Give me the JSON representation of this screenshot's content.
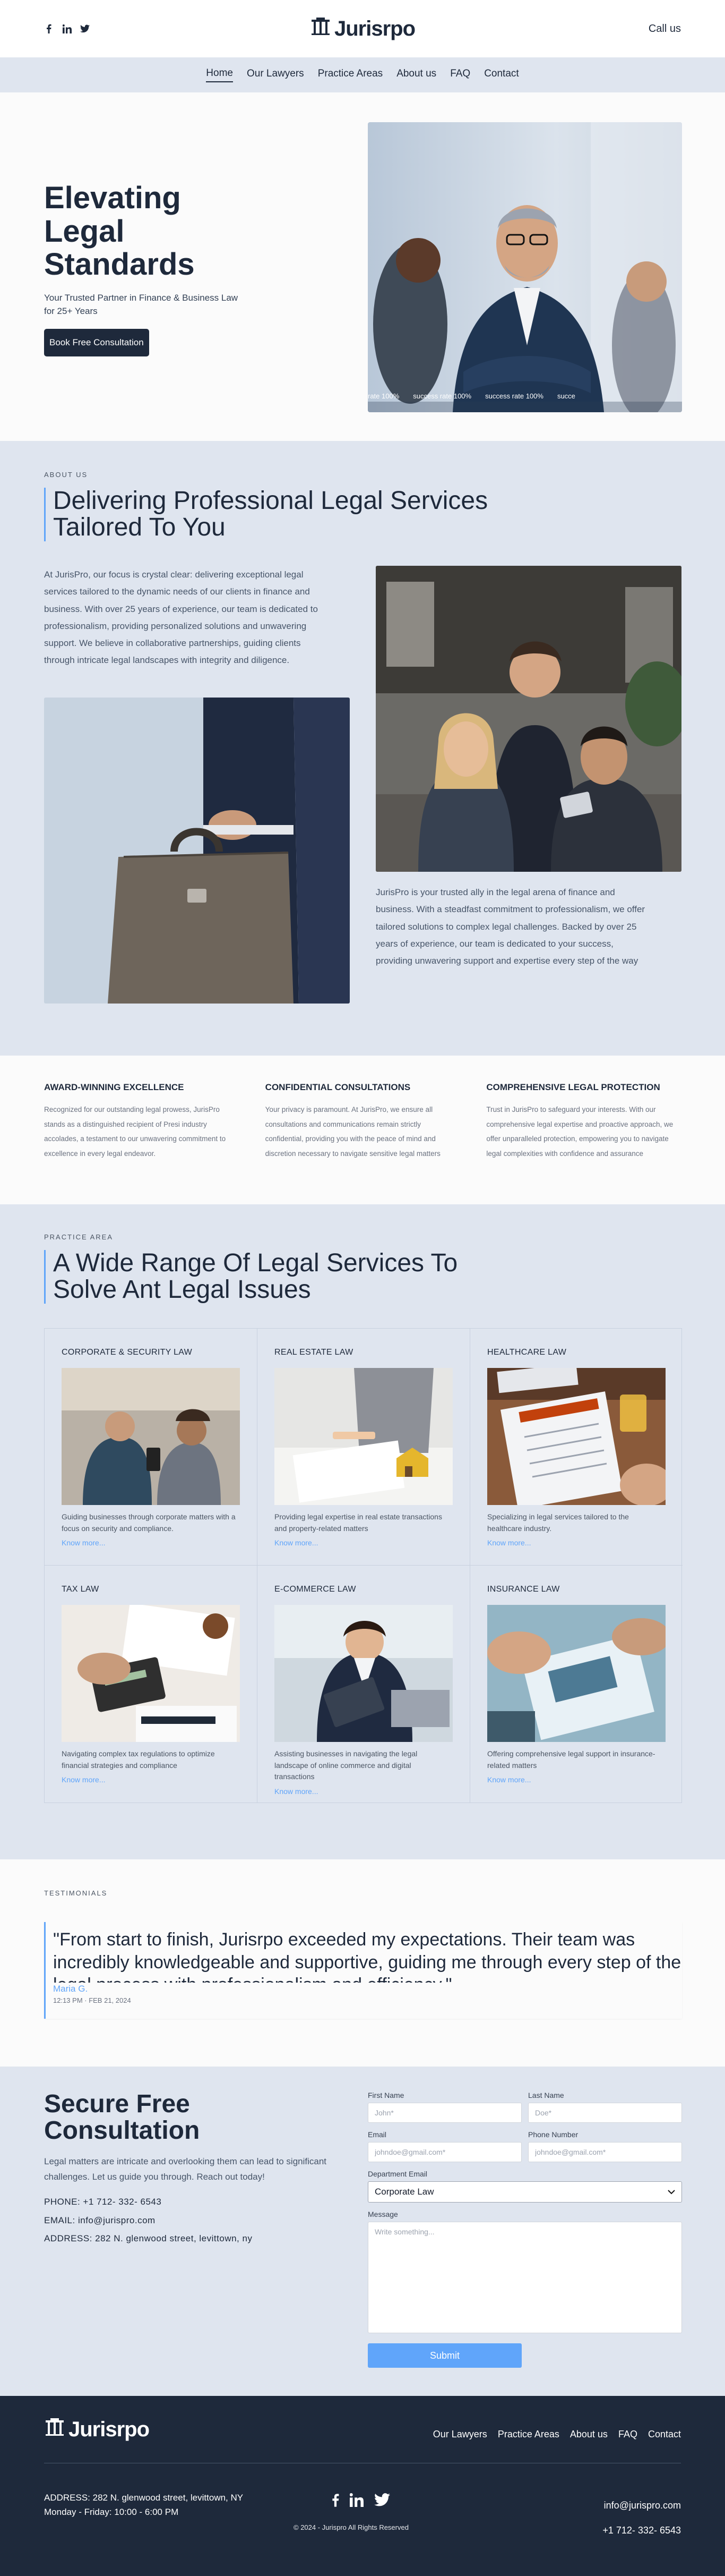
{
  "brand": {
    "name": "Jurisrpo"
  },
  "header": {
    "call_us": "Call us"
  },
  "nav": [
    "Home",
    "Our Lawyers",
    "Practice Areas",
    "About us",
    "FAQ",
    "Contact"
  ],
  "hero": {
    "title": "Elevating Legal Standards",
    "subtitle": "Your Trusted Partner in Finance & Business Law for 25+ Years",
    "cta": "Book Free Consultation",
    "image_ticker": [
      "rate 100%",
      "success rate 100%",
      "success rate 100%",
      "succe"
    ]
  },
  "about": {
    "label": "ABOUT US",
    "title": "Delivering Professional Legal Services Tailored To You",
    "p1": "At JurisPro, our focus is crystal clear: delivering exceptional legal services tailored to the dynamic needs of our clients in finance and business. With over 25 years of experience, our team is dedicated to professionalism, providing personalized solutions and unwavering support. We believe in collaborative partnerships, guiding clients through intricate legal landscapes with integrity and diligence.",
    "p2": "JurisPro is your trusted ally in the legal arena of finance and business. With a steadfast commitment to professionalism, we offer tailored solutions to complex legal challenges. Backed by over 25 years of experience, our team is dedicated to your success, providing unwavering support and expertise every step of the way"
  },
  "features": [
    {
      "title": "AWARD-WINNING EXCELLENCE",
      "text": "Recognized for our outstanding legal prowess, JurisPro stands as a distinguished recipient of Presi industry accolades, a testament to our unwavering commitment to excellence in every legal endeavor."
    },
    {
      "title": "CONFIDENTIAL CONSULTATIONS",
      "text": "Your privacy is paramount. At JurisPro, we ensure all consultations and communications remain strictly confidential, providing you with the peace of mind and discretion necessary to navigate sensitive legal matters"
    },
    {
      "title": "COMPREHENSIVE LEGAL PROTECTION",
      "text": "Trust in JurisPro to safeguard your interests. With our comprehensive legal expertise and proactive approach, we offer unparalleled protection, empowering you to navigate legal complexities with confidence and assurance"
    }
  ],
  "practice": {
    "label": "PRACTICE AREA",
    "title": "A Wide Range Of Legal Services To Solve Ant Legal Issues",
    "more": "Know more...",
    "cards": [
      {
        "title": "CORPORATE & SECURITY LAW",
        "text": "Guiding businesses through corporate matters with a focus on security and compliance."
      },
      {
        "title": "REAL ESTATE LAW",
        "text": "Providing legal expertise in real estate transactions and property-related matters"
      },
      {
        "title": "HEALTHCARE LAW",
        "text": "Specializing in legal services tailored to the healthcare industry."
      },
      {
        "title": "TAX LAW",
        "text": "Navigating complex tax regulations to optimize financial strategies and compliance"
      },
      {
        "title": "E-COMMERCE LAW",
        "text": "Assisting businesses in navigating the legal landscape of online commerce and digital transactions"
      },
      {
        "title": "INSURANCE LAW",
        "text": "Offering comprehensive legal support in insurance-related matters"
      }
    ]
  },
  "testimonials": {
    "label": "TESTIMONIALS",
    "quote": "\"From start to finish, Jurisrpo exceeded my expectations. Their team was incredibly knowledgeable and supportive, guiding me through every step of the legal process with professionalism and efficiency.\"",
    "name": "Maria G.",
    "date": "12:13 PM · FEB 21, 2024"
  },
  "contact": {
    "title": "Secure Free Consultation",
    "subtitle": "Legal matters are intricate and overlooking them can lead to significant challenges. Let us guide you through. Reach out today!",
    "phone": "PHONE: +1 712- 332- 6543",
    "email": "EMAIL: info@jurispro.com",
    "address": "ADDRESS: 282 N. glenwood street, levittown, ny",
    "form": {
      "first_label": "First Name",
      "first_ph": "John*",
      "last_label": "Last Name",
      "last_ph": "Doe*",
      "email_label": "Email",
      "email_ph": "johndoe@gmail.com*",
      "phone_label": "Phone Number",
      "phone_ph": "johndoe@gmail.com*",
      "dept_label": "Department Email",
      "dept_value": "Corporate Law",
      "message_label": "Message",
      "message_ph": "Write something...",
      "submit": "Submit"
    }
  },
  "footer": {
    "nav": [
      "Our Lawyers",
      "Practice Areas",
      "About us",
      "FAQ",
      "Contact"
    ],
    "address": "ADDRESS: 282 N. glenwood street, levittown, NY",
    "hours": "Monday - Friday: 10:00 - 6:00 PM",
    "copyright": "© 2024 - Jurispro All Rights Reserved",
    "email": "info@jurispro.com",
    "phone": "+1 712- 332- 6543"
  },
  "colors": {
    "dark": "#1e293b",
    "accent": "#60a5fa",
    "band": "#dfe5ef",
    "light": "#fbfbfb"
  },
  "icons": [
    "facebook-icon",
    "linkedin-icon",
    "twitter-icon",
    "pillar-logo-icon",
    "chevron-down-icon"
  ]
}
